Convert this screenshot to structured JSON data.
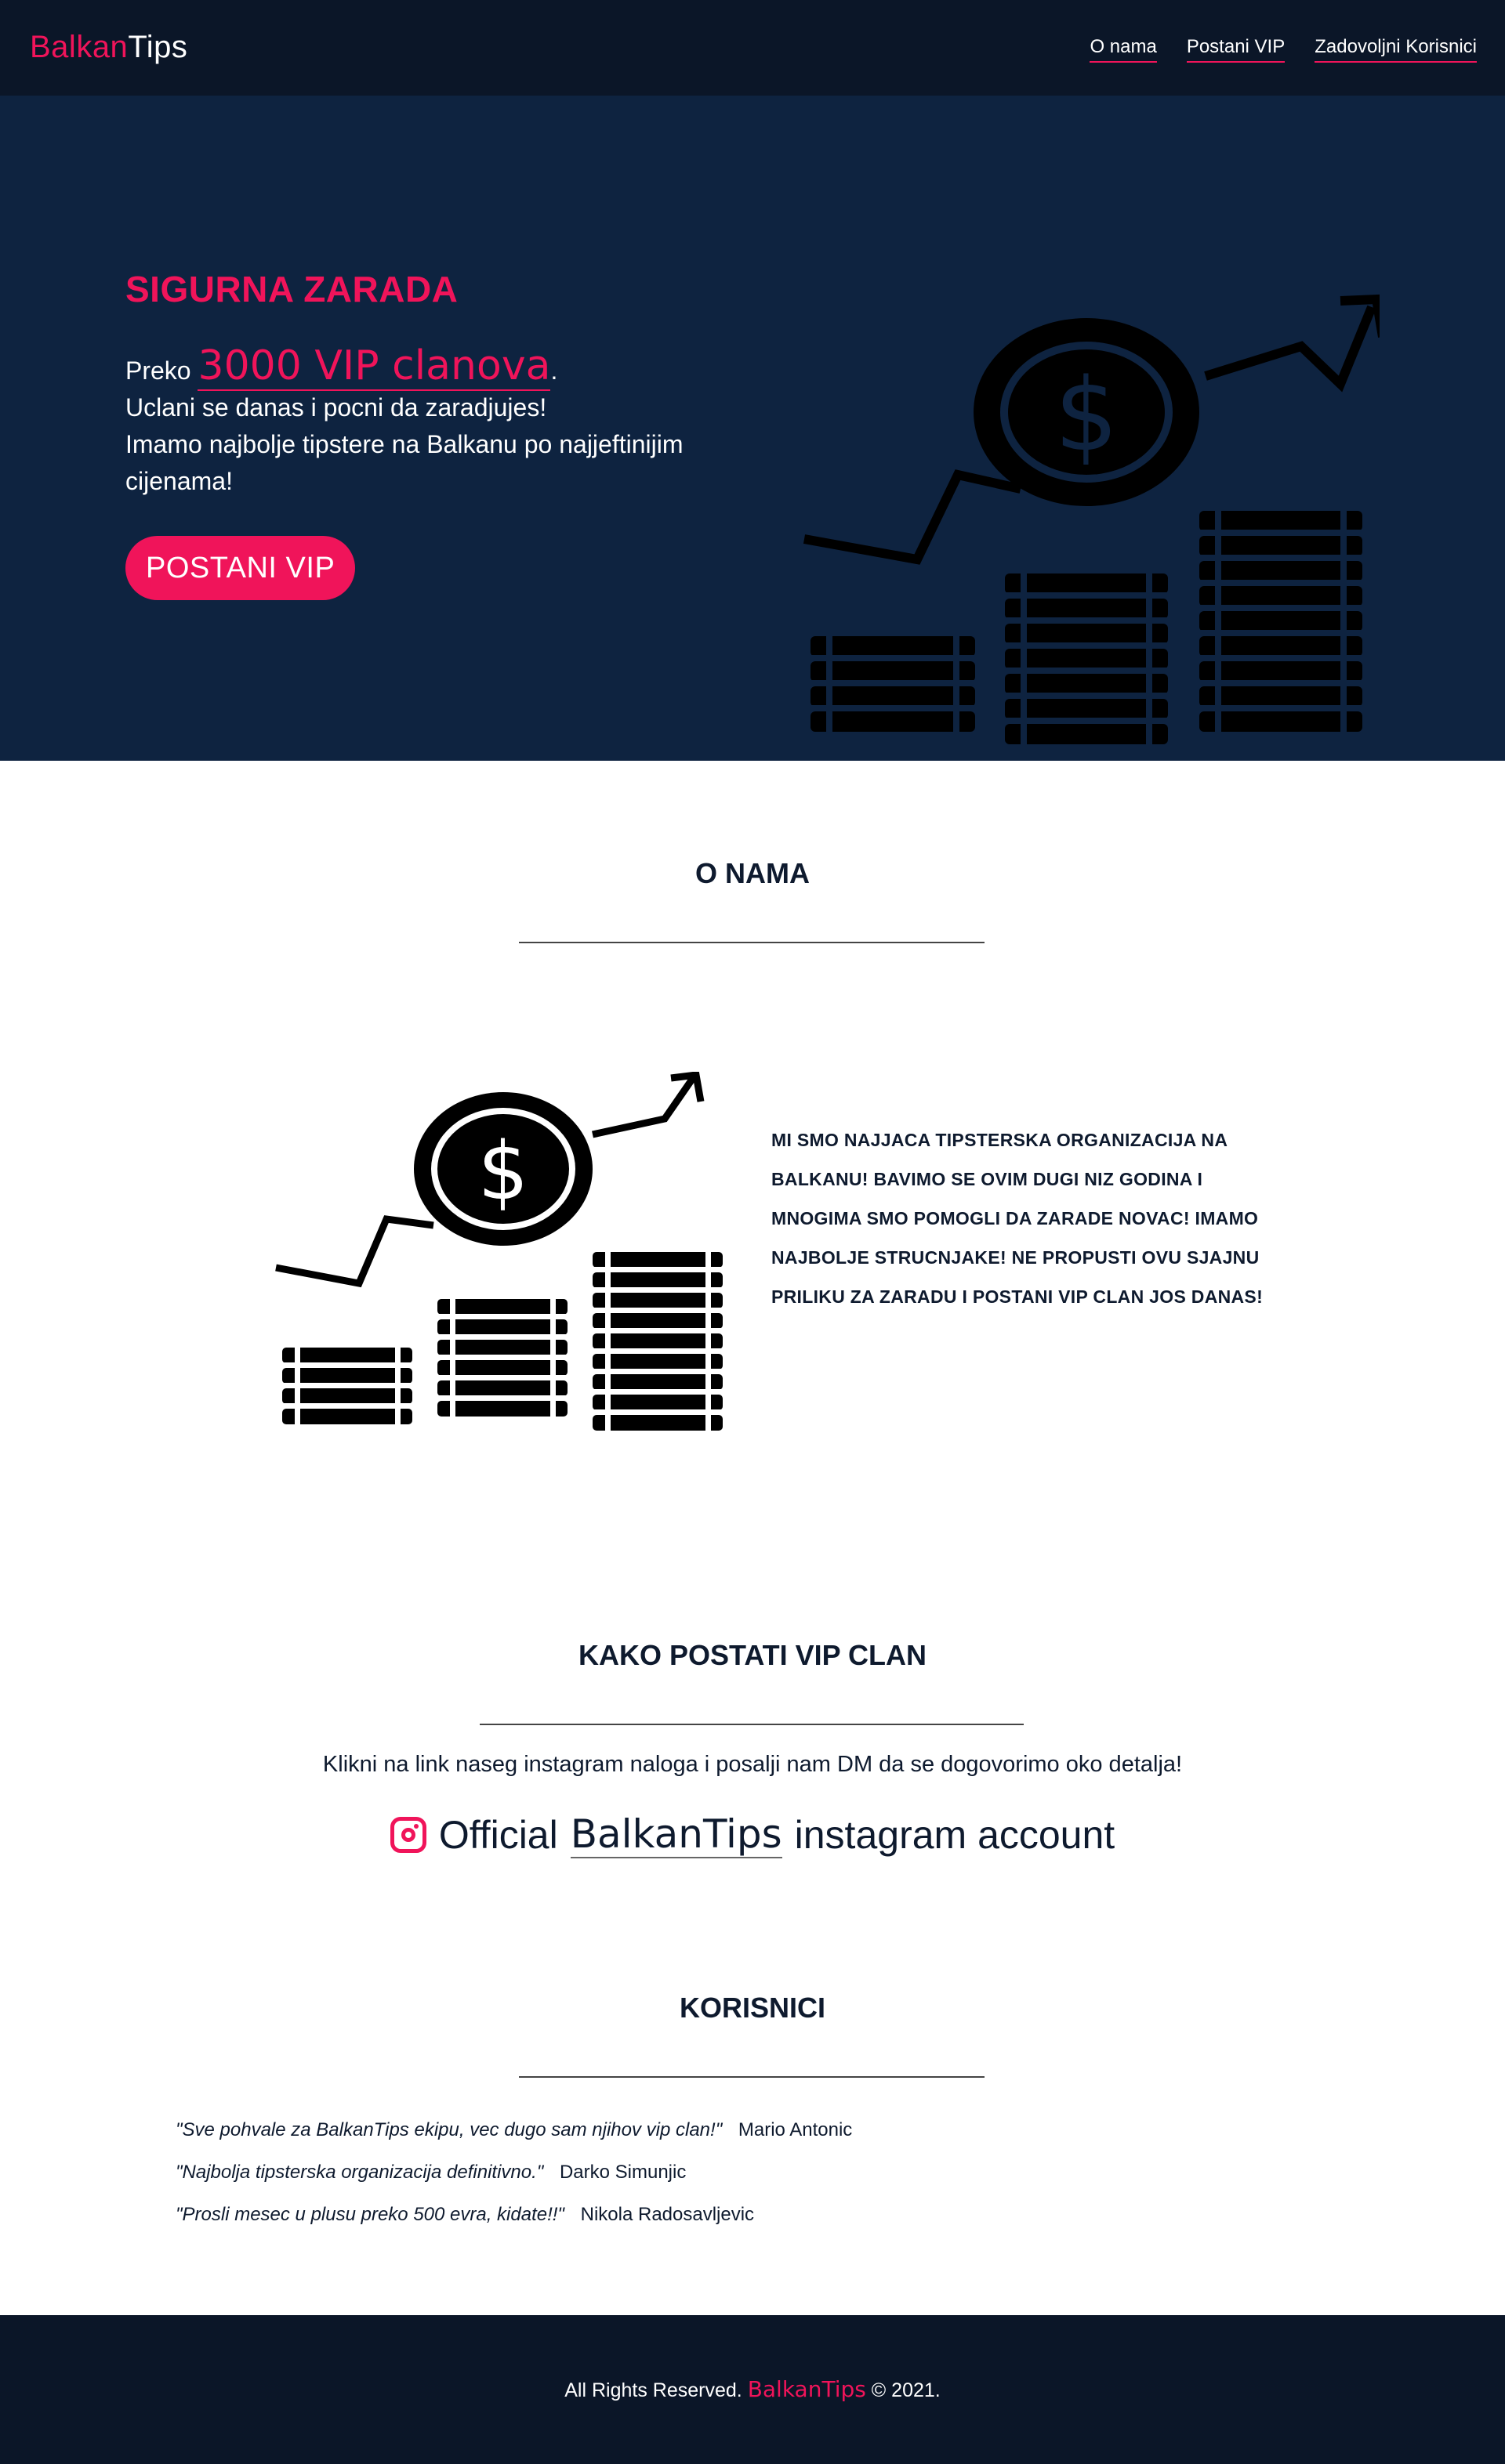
{
  "nav": {
    "brand_part1": "Balkan",
    "brand_part2": "Tips",
    "links": [
      "O nama",
      "Postani VIP",
      "Zadovoljni Korisnici"
    ]
  },
  "hero": {
    "title": "SIGURNA ZARADA",
    "preko": "Preko",
    "vip_count": "3000 VIP clanova",
    "period": ".",
    "line2": "Uclani se danas i pocni da zaradjujes!",
    "line3": "Imamo najbolje tipstere na Balkanu po najjeftinijim cijenama!",
    "button": "POSTANI VIP"
  },
  "about": {
    "title": "O NAMA",
    "text": "MI SMO NAJJACA TIPSTERSKA ORGANIZACIJA NA BALKANU! BAVIMO SE OVIM DUGI NIZ GODINA I MNOGIMA SMO POMOGLI DA ZARADE NOVAC! IMAMO NAJBOLJE STRUCNJAKE! NE PROPUSTI OVU SJAJNU PRILIKU ZA ZARADU I POSTANI VIP CLAN JOS DANAS!"
  },
  "vip": {
    "title": "KAKO POSTATI VIP CLAN",
    "desc": "Klikni na link naseg instagram naloga i posalji nam DM da se dogovorimo oko detalja!",
    "ig_prefix": "Official",
    "ig_link": "BalkanTips",
    "ig_suffix": "instagram account"
  },
  "users": {
    "title": "KORISNICI",
    "reviews": [
      {
        "quote": "\"Sve pohvale za BalkanTips ekipu, vec dugo sam njihov vip clan!\"",
        "author": "Mario Antonic"
      },
      {
        "quote": "\"Najbolja tipsterska organizacija definitivno.\"",
        "author": "Darko Simunjic"
      },
      {
        "quote": "\"Prosli mesec u plusu preko 500 evra, kidate!!\"",
        "author": "Nikola Radosavljevic"
      }
    ]
  },
  "footer": {
    "pre": "All Rights Reserved.",
    "brand": "BalkanTips",
    "post": "© 2021."
  },
  "colors": {
    "accent": "#f0145a",
    "nav_bg": "#0b1628",
    "hero_bg": "#0e2340"
  },
  "icons": [
    "money-growth-icon",
    "instagram-icon"
  ]
}
